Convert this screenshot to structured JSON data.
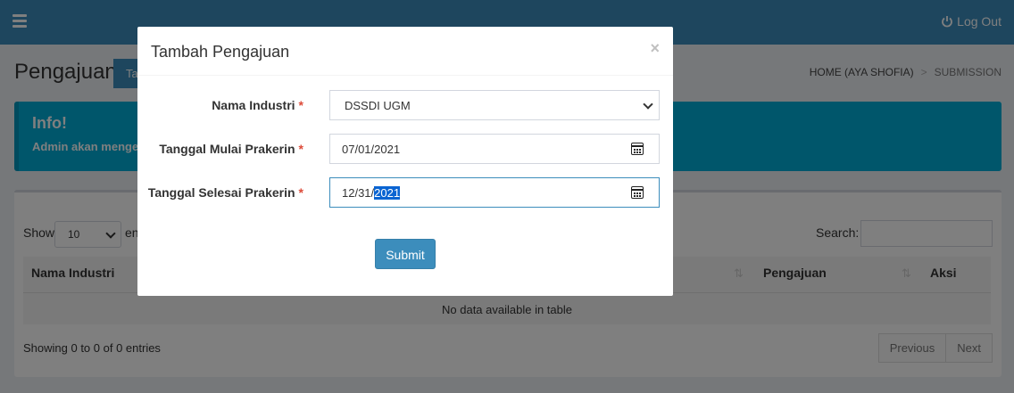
{
  "topbar": {
    "logout_label": "Log Out"
  },
  "header": {
    "title": "Pengajuan",
    "add_button_label": "Tambah",
    "breadcrumb": {
      "home": "HOME (AYA SHOFIA)",
      "separator": ">",
      "current": "SUBMISSION"
    }
  },
  "callout": {
    "title": "Info!",
    "text": "Admin akan mengecek"
  },
  "table_controls": {
    "show_label": "Show",
    "show_value": "10",
    "entries_label": "en",
    "search_label": "Search:"
  },
  "table": {
    "columns": [
      "Nama Industri",
      "Pengajuan",
      "Aksi"
    ],
    "empty_message": "No data available in table",
    "info": "Showing 0 to 0 of 0 entries"
  },
  "pagination": {
    "previous": "Previous",
    "next": "Next"
  },
  "modal": {
    "title": "Tambah Pengajuan",
    "close": "×",
    "fields": {
      "industri": {
        "label": "Nama Industri",
        "required": "*",
        "value": "DSSDI UGM"
      },
      "mulai": {
        "label": "Tanggal Mulai Prakerin",
        "required": "*",
        "value": "07/01/2021"
      },
      "selesai": {
        "label": "Tanggal Selesai Prakerin",
        "required": "*",
        "value_prefix": "12/31/",
        "value_selected": "2021"
      }
    },
    "submit_label": "Submit"
  },
  "colors": {
    "primary": "#3c8dbc",
    "info": "#00c0ef",
    "danger": "#dd4b39"
  }
}
